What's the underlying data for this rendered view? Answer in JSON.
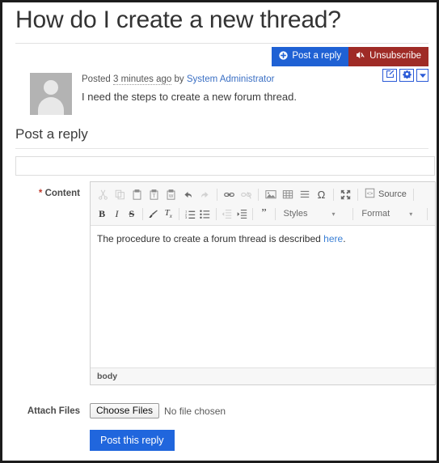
{
  "thread": {
    "title": "How do I create a new thread?",
    "post": {
      "posted_prefix": "Posted",
      "time_ago": "3 minutes ago",
      "by_label": "by",
      "author": "System Administrator",
      "body": "I need the steps to create a new forum thread."
    },
    "actions": {
      "post_reply_label": "Post a reply",
      "post_reply_icon": "plus-circle-icon",
      "unsubscribe_label": "Unsubscribe",
      "unsubscribe_icon": "bell-slash-icon",
      "edit_icon": "edit-square-icon",
      "settings_icon": "gear-icon",
      "more_icon": "caret-down-icon"
    }
  },
  "reply_form": {
    "heading": "Post a reply",
    "subject": {
      "value": "",
      "placeholder": ""
    },
    "content_label": "Content",
    "required_marker": "*",
    "editor": {
      "toolbar_row1": [
        {
          "name": "cut-icon",
          "title": "Cut",
          "disabled": true
        },
        {
          "name": "copy-icon",
          "title": "Copy",
          "disabled": true
        },
        {
          "name": "paste-icon",
          "title": "Paste",
          "disabled": false
        },
        {
          "name": "paste-text-icon",
          "title": "Paste as plain text",
          "disabled": false
        },
        {
          "name": "paste-word-icon",
          "title": "Paste from Word",
          "disabled": false
        },
        {
          "name": "undo-icon",
          "title": "Undo",
          "disabled": false
        },
        {
          "name": "redo-icon",
          "title": "Redo",
          "disabled": true
        },
        {
          "name": "link-icon",
          "title": "Link",
          "disabled": false
        },
        {
          "name": "unlink-icon",
          "title": "Unlink",
          "disabled": true
        },
        {
          "name": "image-icon",
          "title": "Image",
          "disabled": false
        },
        {
          "name": "table-icon",
          "title": "Table",
          "disabled": false
        },
        {
          "name": "horizontal-rule-icon",
          "title": "Horizontal Line",
          "disabled": false
        },
        {
          "name": "special-char-icon",
          "title": "Insert Special Character",
          "disabled": false
        },
        {
          "name": "maximize-icon",
          "title": "Maximize",
          "disabled": false
        }
      ],
      "source_label": "Source",
      "source_icon": "source-code-icon",
      "toolbar_row2": [
        {
          "name": "bold-icon",
          "title": "Bold",
          "disabled": false
        },
        {
          "name": "italic-icon",
          "title": "Italic",
          "disabled": false
        },
        {
          "name": "strikethrough-icon",
          "title": "Strikethrough",
          "disabled": false
        },
        {
          "name": "remove-format-brush-icon",
          "title": "Copy Formatting",
          "disabled": false
        },
        {
          "name": "remove-format-icon",
          "title": "Remove Format",
          "disabled": false
        },
        {
          "name": "numbered-list-icon",
          "title": "Insert/Remove Numbered List",
          "disabled": false
        },
        {
          "name": "bulleted-list-icon",
          "title": "Insert/Remove Bulleted List",
          "disabled": false
        },
        {
          "name": "outdent-icon",
          "title": "Decrease Indent",
          "disabled": true
        },
        {
          "name": "indent-icon",
          "title": "Increase Indent",
          "disabled": false
        },
        {
          "name": "blockquote-icon",
          "title": "Block Quote",
          "disabled": false
        }
      ],
      "styles_label": "Styles",
      "format_label": "Format",
      "combo_arrow": "▾",
      "content_text_before": "The procedure to create a forum thread is described ",
      "content_link_text": "here",
      "content_text_after": ".",
      "status_path": "body"
    },
    "attach_label": "Attach Files",
    "choose_files_label": "Choose Files",
    "file_status": "No file chosen",
    "submit_label": "Post this reply"
  },
  "colors": {
    "primary_blue": "#1f61d4",
    "danger_red": "#9f2b26",
    "submit_blue": "#2066dd",
    "link_blue": "#3a6fc4",
    "editor_link": "#3a7fd5",
    "required_red": "#c0392b",
    "avatar_gray": "#b3b3b3"
  }
}
